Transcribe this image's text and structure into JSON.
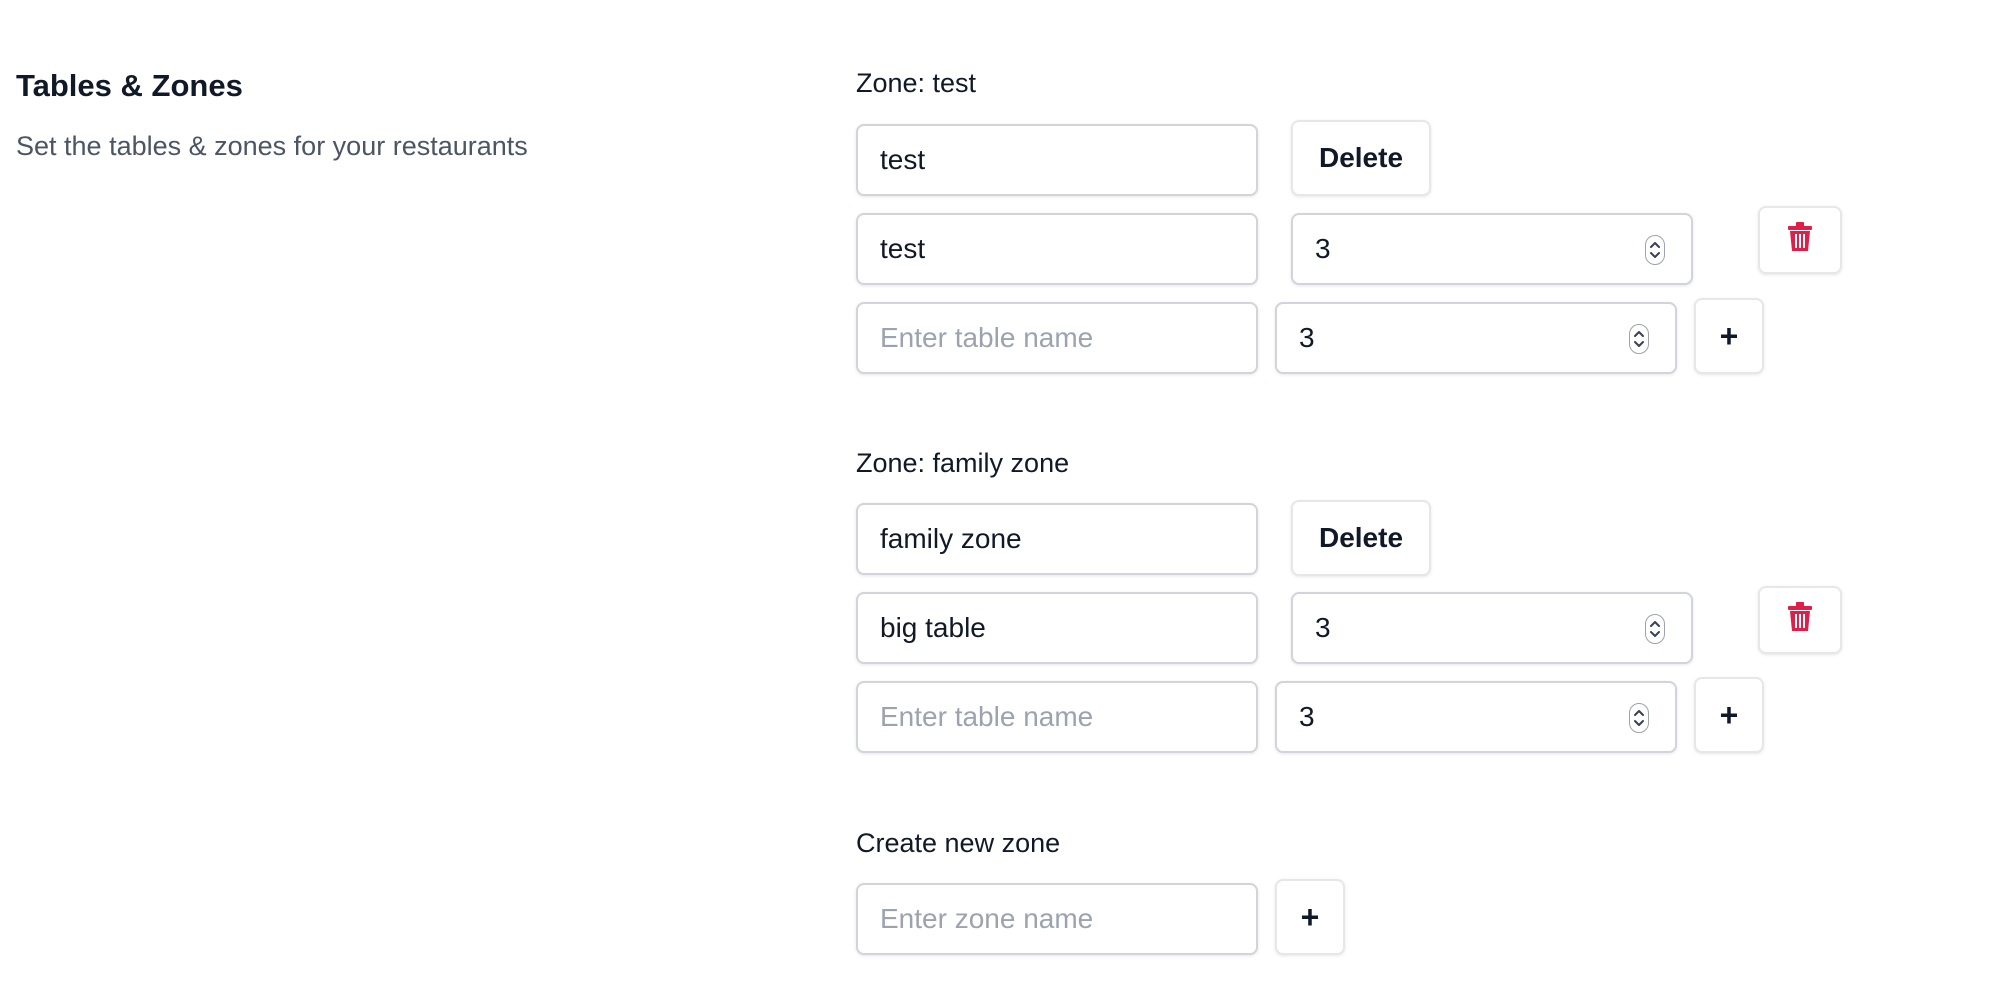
{
  "section": {
    "title": "Tables & Zones",
    "description": "Set the tables & zones for your restaurants"
  },
  "zones": [
    {
      "label": "Zone: test",
      "name_value": "test",
      "delete_label": "Delete",
      "tables": [
        {
          "name": "test",
          "capacity": "3"
        }
      ],
      "new_table": {
        "placeholder": "Enter table name",
        "capacity": "3",
        "add_label": "+"
      }
    },
    {
      "label": "Zone: family zone",
      "name_value": "family zone",
      "delete_label": "Delete",
      "tables": [
        {
          "name": "big table",
          "capacity": "3"
        }
      ],
      "new_table": {
        "placeholder": "Enter table name",
        "capacity": "3",
        "add_label": "+"
      }
    }
  ],
  "create_zone": {
    "label": "Create new zone",
    "placeholder": "Enter zone name",
    "add_label": "+"
  },
  "colors": {
    "text": "#111827",
    "muted": "#4b5563",
    "placeholder": "#9ca3af",
    "border": "#d1d5db",
    "danger": "#e11d48"
  },
  "icons": {
    "delete_table": "trash-icon",
    "stepper": "chevron-up-down-icon"
  }
}
